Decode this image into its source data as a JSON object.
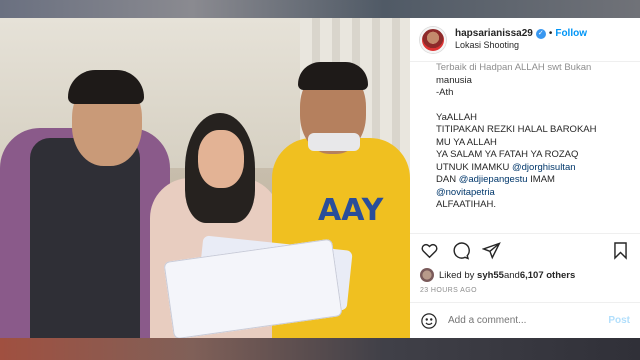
{
  "post": {
    "username": "hapsarianissa29",
    "verified_mark": "✓",
    "separator": "•",
    "follow_label": "Follow",
    "location": "Lokasi Shooting",
    "more_icon": "more-dots-icon"
  },
  "caption": {
    "faded_line_1": "Terbaik di Hadpan ALLAH swt Bukan",
    "line_manusia": "manusia",
    "line_ath": "-Ath",
    "line_yaallah": "YaALLAH",
    "line_1": "TITIPAKAN REZKI HALAL BAROKAH",
    "line_2": "MU YA ALLAH",
    "line_3": "YA SALAM YA FATAH YA ROZAQ",
    "line_4_prefix": "UTNUK IMAMKU ",
    "mention_1": "@djorghisultan",
    "line_5_prefix": "DAN ",
    "mention_2": "@adjiepangestu",
    "line_5_suffix": " IMAM",
    "mention_3": "@novitapetria",
    "line_7": "ALFAATIHAH."
  },
  "actions": {
    "like_icon": "heart-icon",
    "comment_icon": "comment-icon",
    "share_icon": "share-icon",
    "save_icon": "bookmark-icon"
  },
  "likes": {
    "prefix": "Liked by ",
    "user": "syh55",
    "middle": " and ",
    "count": "6,107 others"
  },
  "timestamp": "23 HOURS AGO",
  "comment": {
    "placeholder": "Add a comment...",
    "post_label": "Post",
    "emoji_icon": "smiley-icon"
  },
  "photo": {
    "shirt_print": "AAY"
  },
  "colors": {
    "accent": "#0095f6",
    "shirt": "#f0c020"
  }
}
